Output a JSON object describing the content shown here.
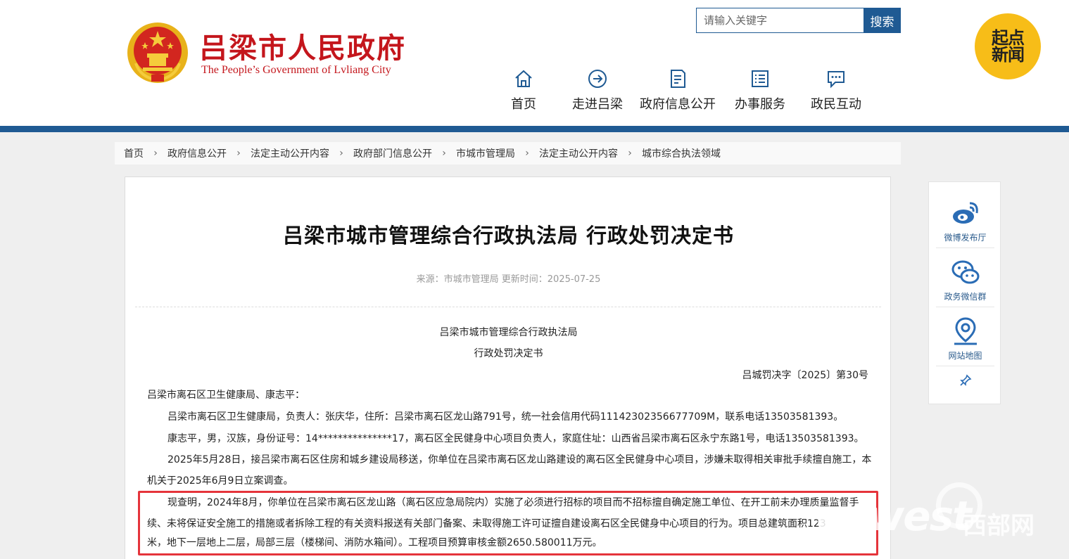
{
  "header": {
    "site_title": "吕梁市人民政府",
    "site_subtitle": "The People’s Government of Lvliang City",
    "search_placeholder": "请输入关键字",
    "search_button": "搜索",
    "logo_badge": [
      "起点",
      "新闻"
    ],
    "nav": [
      {
        "label": "首页",
        "icon": "home-icon"
      },
      {
        "label": "走进吕梁",
        "icon": "arrow-circle-icon"
      },
      {
        "label": "政府信息公开",
        "icon": "document-icon"
      },
      {
        "label": "办事服务",
        "icon": "list-icon"
      },
      {
        "label": "政民互动",
        "icon": "chat-icon"
      }
    ],
    "colors": {
      "brand_red": "#c4161c",
      "brand_blue": "#1f5a93"
    }
  },
  "breadcrumb": [
    "首页",
    "政府信息公开",
    "法定主动公开内容",
    "政府部门信息公开",
    "市城市管理局",
    "法定主动公开内容",
    "城市综合执法领域"
  ],
  "article": {
    "title": "吕梁市城市管理综合行政执法局 行政处罚决定书",
    "meta": "来源：市城市管理局 更新时间：2025-07-25",
    "org_line": "吕梁市城市管理综合行政执法局",
    "doc_type_line": "行政处罚决定书",
    "doc_number": "吕城罚决字〔2025〕第30号",
    "addressee": "吕梁市离石区卫生健康局、康志平：",
    "para1": "吕梁市离石区卫生健康局，负责人：张庆华，住所：吕梁市离石区龙山路791号，统一社会信用代码11142302356677709M，联系电话13503581393。",
    "para2": "康志平，男，汉族，身份证号：14***************17，离石区全民健身中心项目负责人，家庭住址：山西省吕梁市离石区永宁东路1号，电话13503581393。",
    "para3_line1": "2025年5月28日，接吕梁市离石区住房和城乡建设局移送，你单位在吕梁市离石区龙山路建设的离石区全民健身中心项目，涉嫌未取得相关审批手续擅自施工，本",
    "para3_line2": "机关于2025年6月9日立案调查。",
    "para4_line1": "现查明，2024年8月，你单位在吕梁市离石区龙山路（离石区应急局院内）实施了必须进行招标的项目而不招标擅自确定施工单位、在开工前未办理质量监督手",
    "para4_line2": "续、未将保证安全施工的措施或者拆除工程的有关资料报送有关部门备案、未取得施工许可证擅自建设离石区全民健身中心项目的行为。项目总建筑面积123",
    "para4_line3": "米，地下一层地上二层，局部三层（楼梯间、消防水箱间）。工程项目预算审核金额2650.580011万元。"
  },
  "side_panel": [
    {
      "label": "微博发布厅",
      "icon": "weibo-icon"
    },
    {
      "label": "政务微信群",
      "icon": "wechat-icon"
    },
    {
      "label": "网站地图",
      "icon": "map-pin-icon"
    }
  ],
  "watermark": {
    "brand": "cnwest",
    "cn": "西部网"
  }
}
